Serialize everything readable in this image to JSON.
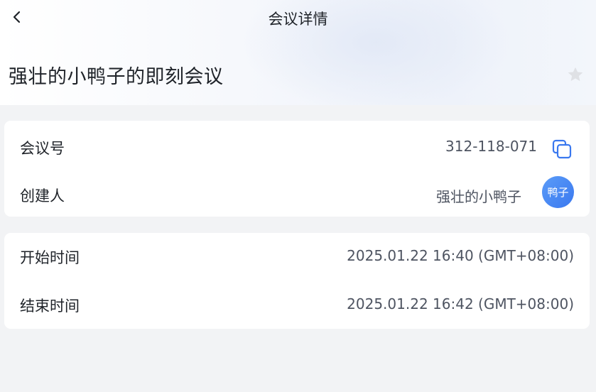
{
  "header": {
    "title": "会议详情",
    "back_icon": "chevron-left-icon"
  },
  "meeting": {
    "title": "强壮的小鸭子的即刻会议",
    "favorite_icon": "star-icon",
    "favorited": false
  },
  "info_card": {
    "meeting_id_label": "会议号",
    "meeting_id_value": "312-118-071",
    "copy_icon": "copy-icon",
    "creator_label": "创建人",
    "creator_value": "强壮的小鸭子",
    "creator_avatar_text": "鸭子"
  },
  "time_card": {
    "start_label": "开始时间",
    "start_value": "2025.01.22 16:40 (GMT+08:00)",
    "end_label": "结束时间",
    "end_value": "2025.01.22 16:42 (GMT+08:00)"
  },
  "colors": {
    "accent": "#3a78ef",
    "background": "#f2f3f5",
    "card": "#ffffff",
    "text_primary": "#1f2329",
    "text_secondary": "#4e5461"
  }
}
